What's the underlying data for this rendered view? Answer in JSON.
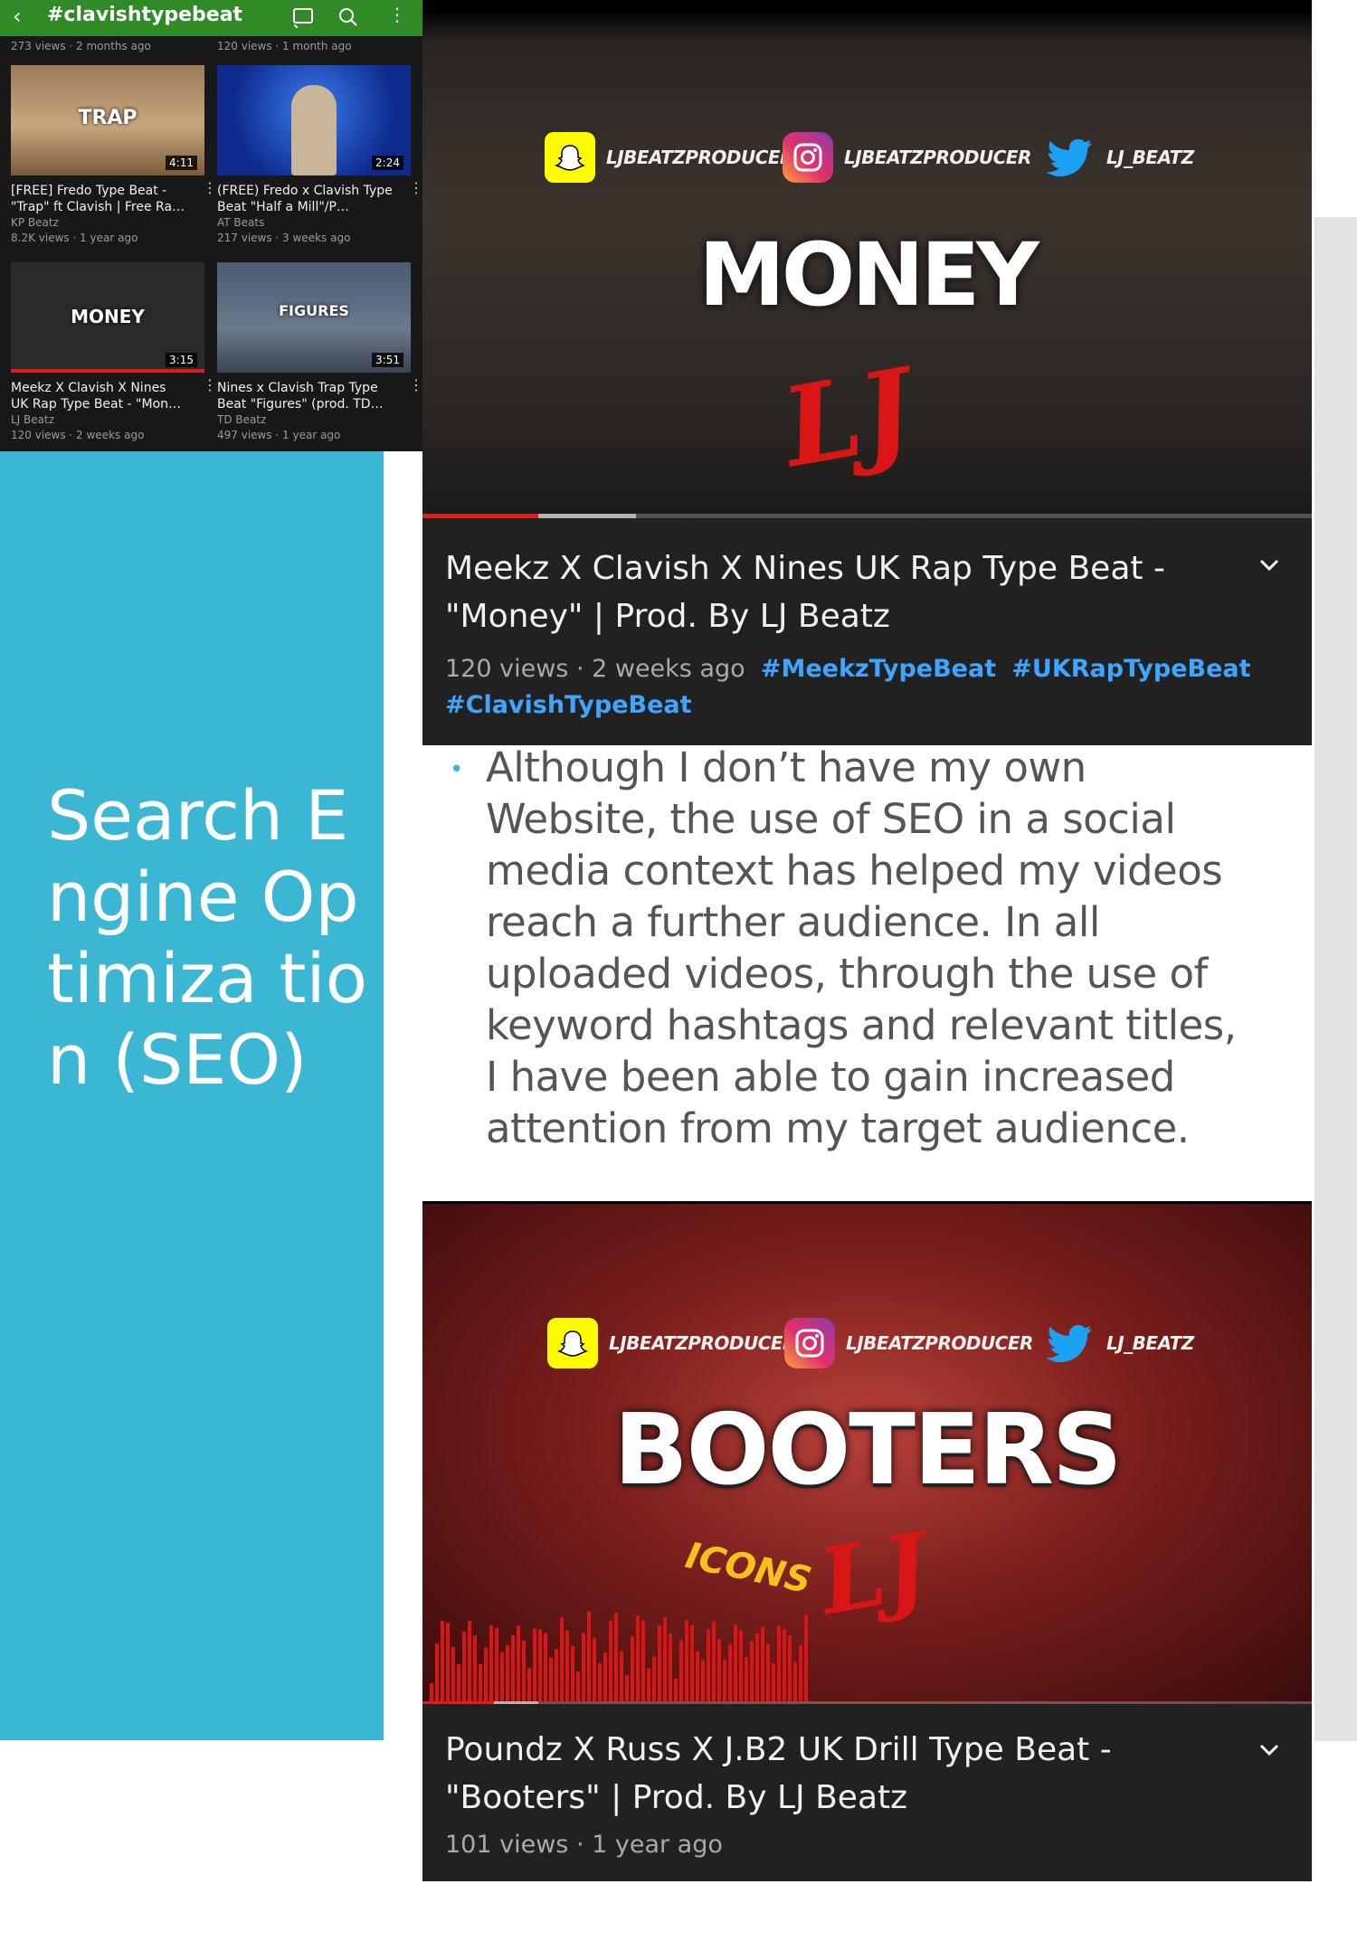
{
  "slide": {
    "title": "Search Engine Optimiza tion (SEO)",
    "body_text": "Although I don’t have my own Website, the use of SEO in a social media context has helped my videos reach a further audience. In all uploaded videos, through the use of keyword hashtags and relevant titles, I have been able to gain increased attention from my target audience."
  },
  "phone": {
    "search_title": "#clavishtypebeat",
    "top_row": [
      "273 views · 2 months ago",
      "120 views · 1 month ago"
    ],
    "videos": [
      {
        "thumb_text": "TRAP",
        "duration": "4:11",
        "title": "[FREE] Fredo Type Beat - \"Trap\" ft Clavish | Free Ra…",
        "channel": "KP Beatz",
        "stats": "8.2K views · 1 year ago"
      },
      {
        "thumb_text": "",
        "duration": "2:24",
        "title": "(FREE) Fredo x Clavish Type Beat \"Half a Mill\"/P…",
        "channel": "AT Beats",
        "stats": "217 views · 3 weeks ago"
      },
      {
        "thumb_text": "MONEY",
        "duration": "3:15",
        "title": "Meekz X Clavish X Nines UK Rap Type Beat - \"Mon…",
        "channel": "LJ Beatz",
        "stats": "120 views · 2 weeks ago"
      },
      {
        "thumb_text": "FIGURES",
        "duration": "3:51",
        "title": "Nines x Clavish Trap Type Beat \"Figures\" (prod. TD…",
        "channel": "TD Beatz",
        "stats": "497 views · 1 year ago"
      }
    ]
  },
  "social": {
    "snapchat": "LJBEATZPRODUCER",
    "instagram": "LJBEATZPRODUCER",
    "twitter": "LJ_BEATZ"
  },
  "video1": {
    "overlay_word": "MONEY",
    "overlay_logo": "LJ",
    "progress": 0.13,
    "buffered": 0.24,
    "title": "Meekz X Clavish X Nines UK Rap Type Beat - \"Money\" | Prod. By LJ Beatz",
    "stats": "120 views · 2 weeks ago",
    "hashtags": [
      "#MeekzTypeBeat",
      "#UKRapTypeBeat",
      "#ClavishTypeBeat"
    ]
  },
  "video2": {
    "overlay_word": "BOOTERS",
    "overlay_sub": "ICONS",
    "overlay_logo": "LJ",
    "progress": 0.08,
    "buffered": 0.13,
    "title": "Poundz X Russ X J.B2 UK Drill Type Beat - \"Booters\" | Prod. By LJ Beatz",
    "stats": "101 views · 1 year ago"
  },
  "colors": {
    "teal": "#3bb7d3",
    "phone_bar": "#2f8a27",
    "hashtag": "#3ea6ff",
    "progress_red": "#e21b1b"
  }
}
